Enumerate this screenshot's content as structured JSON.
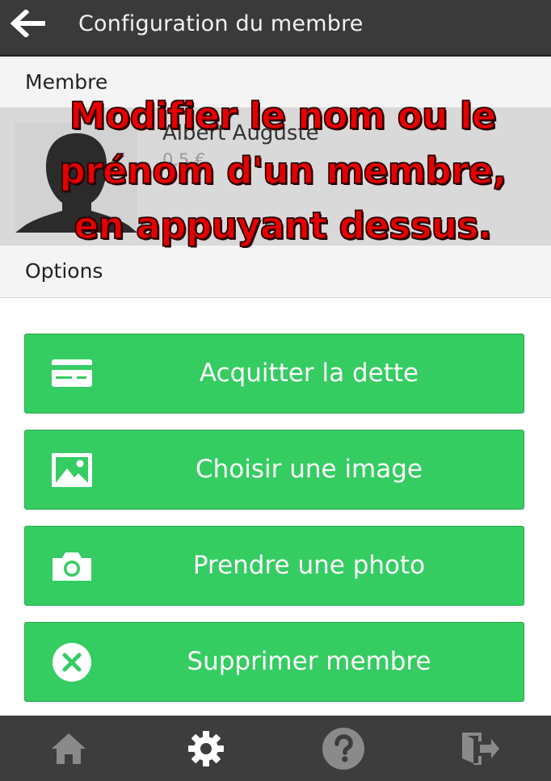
{
  "header": {
    "title": "Configuration du membre",
    "back_icon": "arrow-left-icon"
  },
  "sections": {
    "member_label": "Membre",
    "options_label": "Options"
  },
  "member": {
    "name": "Albert Auguste",
    "debt": "0.5 €",
    "avatar_icon": "person-silhouette-icon"
  },
  "overlay": {
    "lines": [
      "Modifier le nom ou le",
      "prénom d'un membre,",
      "en appuyant dessus."
    ],
    "color": "#e60000"
  },
  "actions": [
    {
      "label": "Acquitter la dette",
      "icon": "credit-card-icon"
    },
    {
      "label": "Choisir une image",
      "icon": "image-icon"
    },
    {
      "label": "Prendre une photo",
      "icon": "camera-icon"
    },
    {
      "label": "Supprimer membre",
      "icon": "close-circle-icon"
    }
  ],
  "bottom_nav": [
    {
      "icon": "home-icon",
      "active": false
    },
    {
      "icon": "gear-icon",
      "active": true
    },
    {
      "icon": "help-icon",
      "active": false
    },
    {
      "icon": "logout-icon",
      "active": false
    }
  ],
  "colors": {
    "accent_green": "#35cc62",
    "bar_dark": "#3a3a3a",
    "overlay_red": "#e60000"
  }
}
